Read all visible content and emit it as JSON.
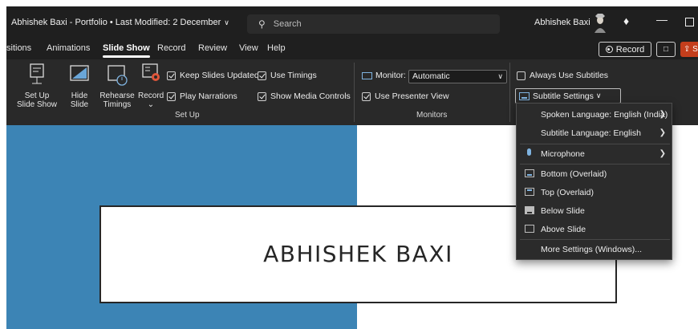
{
  "titlebar": {
    "doc_title": "Abhishek Baxi - Portfolio • Last Modified: 2 December",
    "search_placeholder": "Search",
    "user_name": "Abhishek Baxi"
  },
  "tabs": [
    {
      "label": "sitions"
    },
    {
      "label": "Animations"
    },
    {
      "label": "Slide Show",
      "active": true
    },
    {
      "label": "Record"
    },
    {
      "label": "Review"
    },
    {
      "label": "View"
    },
    {
      "label": "Help"
    }
  ],
  "tabbar": {
    "record_label": "Record",
    "share_label": "Sh"
  },
  "ribbon": {
    "setup": {
      "set_up_slideshow_line1": "Set Up",
      "set_up_slideshow_line2": "Slide Show",
      "hide_slide_line1": "Hide",
      "hide_slide_line2": "Slide",
      "rehearse_line1": "Rehearse",
      "rehearse_line2": "Timings",
      "record_label": "Record",
      "keep_slides_updated": "Keep Slides Updated",
      "play_narrations": "Play Narrations",
      "use_timings": "Use Timings",
      "show_media_controls": "Show Media Controls",
      "group_label": "Set Up"
    },
    "monitors": {
      "monitor_label": "Monitor:",
      "monitor_value": "Automatic",
      "use_presenter_view": "Use Presenter View",
      "group_label": "Monitors"
    },
    "captions": {
      "always_use_subtitles": "Always Use Subtitles",
      "subtitle_settings": "Subtitle Settings"
    }
  },
  "menu": {
    "items": [
      {
        "label": "Spoken Language: English (India)",
        "submenu": true
      },
      {
        "label": "Subtitle Language: English",
        "submenu": true
      },
      {
        "label": "Microphone",
        "submenu": true
      },
      {
        "label": "Bottom (Overlaid)"
      },
      {
        "label": "Top (Overlaid)"
      },
      {
        "label": "Below Slide",
        "selected": true
      },
      {
        "label": "Above Slide"
      },
      {
        "label": "More Settings (Windows)..."
      }
    ]
  },
  "slide": {
    "title": "ABHISHEK BAXI"
  },
  "colors": {
    "accent_blue": "#3c84b5",
    "share_orange": "#c43e1c",
    "ribbon_bg": "#292929",
    "titlebar_bg": "#1f1f1f"
  }
}
